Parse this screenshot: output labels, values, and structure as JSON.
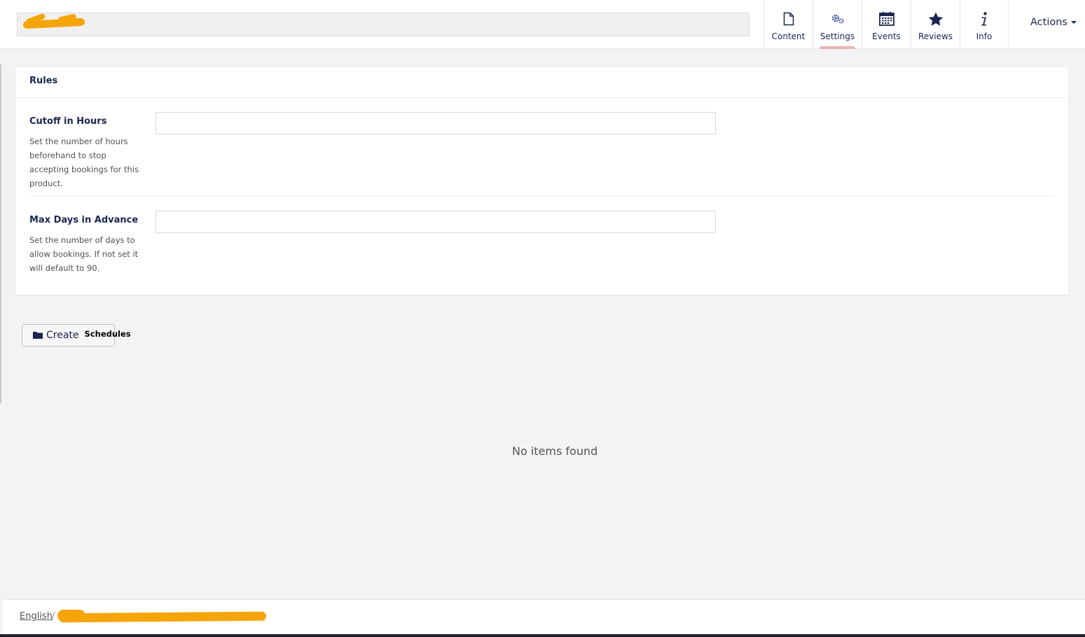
{
  "header": {
    "apps": [
      {
        "label": "Content",
        "icon": "document-icon"
      },
      {
        "label": "Settings",
        "icon": "gears-icon",
        "active": true
      },
      {
        "label": "Events",
        "icon": "calendar-icon"
      },
      {
        "label": "Reviews",
        "icon": "star-icon"
      },
      {
        "label": "Info",
        "icon": "info-icon"
      }
    ],
    "actions_label": "Actions"
  },
  "panel": {
    "title": "Rules",
    "properties": [
      {
        "label": "Cutoff in Hours",
        "description": "Set the number of hours beforehand to stop accepting bookings for this product.",
        "value": ""
      },
      {
        "label": "Max Days in Advance",
        "description": "Set the number of days to allow bookings. If not set it will default to 90.",
        "value": ""
      }
    ]
  },
  "create_button": {
    "label": "Create",
    "type_label": "Schedules"
  },
  "empty_message": "No items found",
  "footer": {
    "language": "English",
    "separator": "/"
  },
  "colors": {
    "brand_text": "#1b264f",
    "active_indicator": "#e9b4b4",
    "redaction": "#f5a50a"
  }
}
